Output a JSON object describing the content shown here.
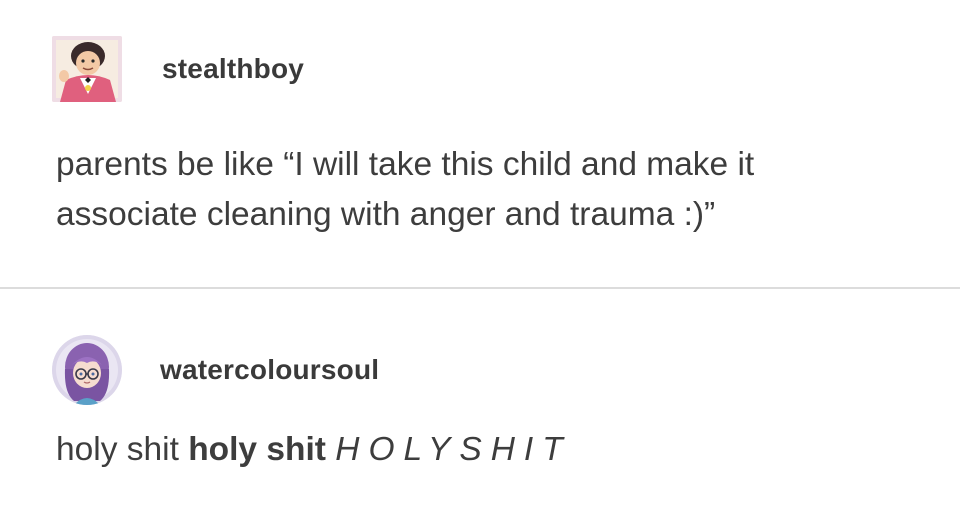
{
  "posts": [
    {
      "username": "stealthboy",
      "avatar_icon": "pink-jacket-cartoon-avatar",
      "body_lines": [
        "parents be like “I will take this child and make it",
        "associate cleaning with anger and trauma :)”"
      ]
    },
    {
      "username": "watercoloursoul",
      "avatar_icon": "purple-haired-anime-avatar",
      "body": {
        "plain": "holy shit ",
        "bold": "holy shit",
        "spaced_italic": "HOLYSHIT"
      }
    }
  ],
  "colors": {
    "background": "#ffffff",
    "text": "#3d3d3d",
    "divider": "#dcdcdc"
  }
}
